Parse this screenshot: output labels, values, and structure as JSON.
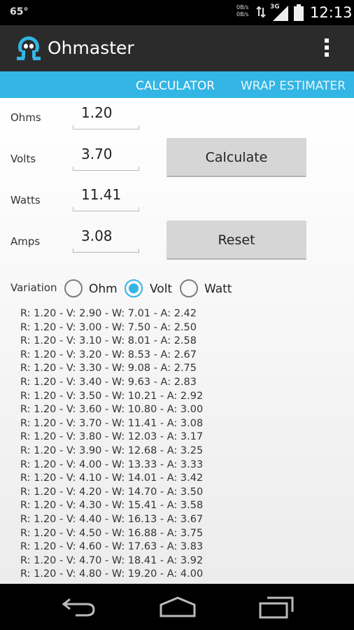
{
  "status_bar": {
    "temperature": "65°",
    "data_rate_up": "0B/s",
    "data_rate_down": "0B/s",
    "network": "3G",
    "time": "12:13"
  },
  "app_bar": {
    "title": "Ohmaster",
    "logo_icon": "omega-logo-icon",
    "menu_icon": "overflow-menu-icon"
  },
  "tabs": [
    {
      "label": "CALCULATOR",
      "selected": true
    },
    {
      "label": "WRAP ESTIMATER",
      "selected": false
    }
  ],
  "form": {
    "ohms": {
      "label": "Ohms",
      "value": "1.20"
    },
    "volts": {
      "label": "Volts",
      "value": "3.70"
    },
    "watts": {
      "label": "Watts",
      "value": "11.41"
    },
    "amps": {
      "label": "Amps",
      "value": "3.08"
    }
  },
  "buttons": {
    "calculate": "Calculate",
    "reset": "Reset"
  },
  "variation": {
    "label": "Variation",
    "options": [
      "Ohm",
      "Volt",
      "Watt"
    ],
    "selected": "Volt"
  },
  "results": [
    "R: 1.20 - V: 2.90 - W: 7.01 - A: 2.42",
    "R: 1.20 - V: 3.00 - W: 7.50 - A: 2.50",
    "R: 1.20 - V: 3.10 - W: 8.01 - A: 2.58",
    "R: 1.20 - V: 3.20 - W: 8.53 - A: 2.67",
    "R: 1.20 - V: 3.30 - W: 9.08 - A: 2.75",
    "R: 1.20 - V: 3.40 - W: 9.63 - A: 2.83",
    "R: 1.20 - V: 3.50 - W: 10.21 - A: 2.92",
    "R: 1.20 - V: 3.60 - W: 10.80 - A: 3.00",
    "R: 1.20 - V: 3.70 - W: 11.41 - A: 3.08",
    "R: 1.20 - V: 3.80 - W: 12.03 - A: 3.17",
    "R: 1.20 - V: 3.90 - W: 12.68 - A: 3.25",
    "R: 1.20 - V: 4.00 - W: 13.33 - A: 3.33",
    "R: 1.20 - V: 4.10 - W: 14.01 - A: 3.42",
    "R: 1.20 - V: 4.20 - W: 14.70 - A: 3.50",
    "R: 1.20 - V: 4.30 - W: 15.41 - A: 3.58",
    "R: 1.20 - V: 4.40 - W: 16.13 - A: 3.67",
    "R: 1.20 - V: 4.50 - W: 16.88 - A: 3.75",
    "R: 1.20 - V: 4.60 - W: 17.63 - A: 3.83",
    "R: 1.20 - V: 4.70 - W: 18.41 - A: 3.92",
    "R: 1.20 - V: 4.80 - W: 19.20 - A: 4.00"
  ],
  "nav_bar": {
    "back_icon": "back-icon",
    "home_icon": "home-icon",
    "recents_icon": "recent-apps-icon"
  },
  "colors": {
    "accent": "#33b5e5",
    "app_bar": "#2b2b2b",
    "button": "#d6d6d6"
  }
}
